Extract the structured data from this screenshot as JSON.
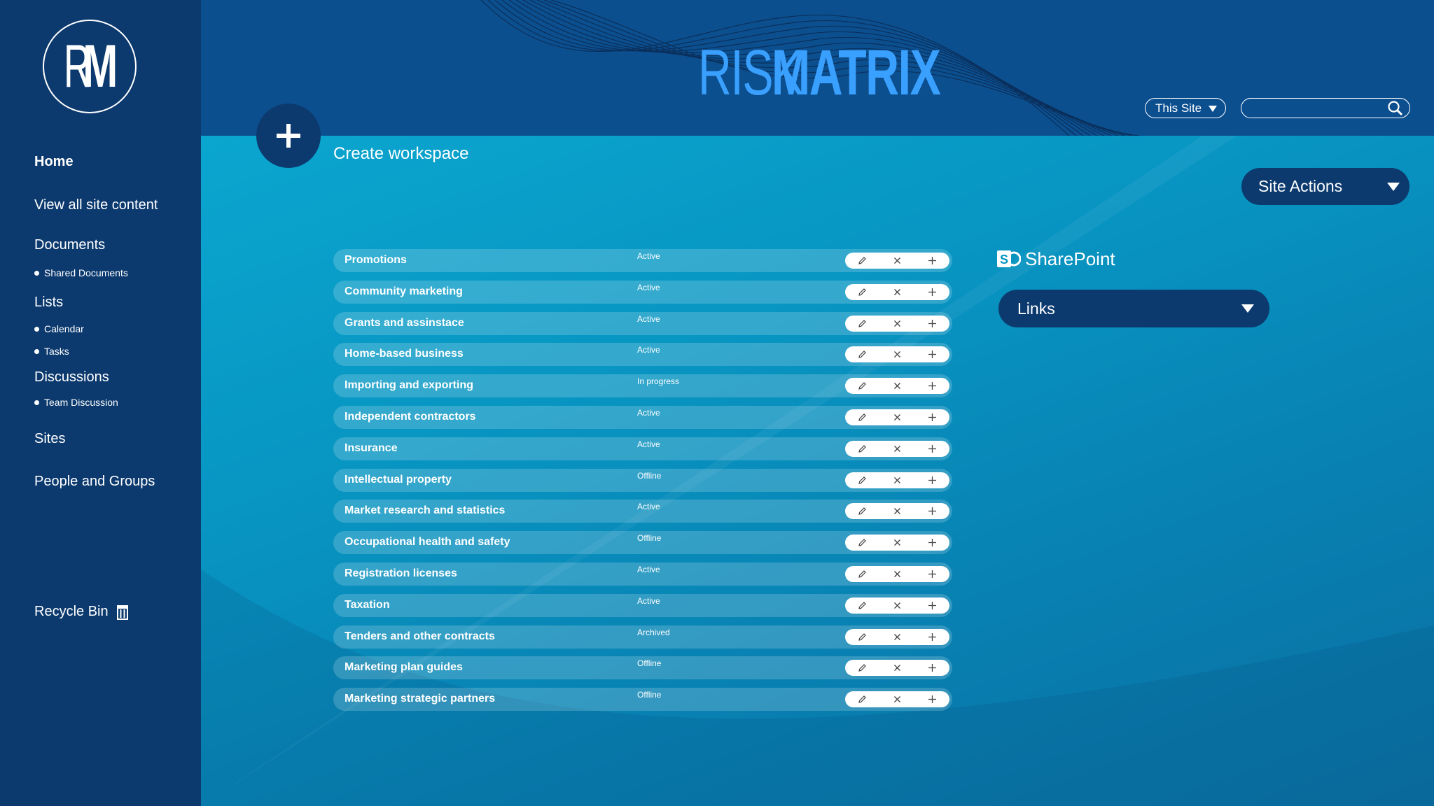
{
  "logo": {
    "left": "R",
    "right": "M"
  },
  "sidebar": {
    "home": "Home",
    "view_all": "View all site content",
    "documents": "Documents",
    "shared_documents": "Shared Documents",
    "lists": "Lists",
    "calendar": "Calendar",
    "tasks": "Tasks",
    "discussions": "Discussions",
    "team_discussion": "Team Discussion",
    "sites": "Sites",
    "people_groups": "People and Groups",
    "recycle_bin": "Recycle Bin"
  },
  "header": {
    "brand_light": "RISK",
    "brand_bold": "MATRIX",
    "scope": "This Site",
    "search_placeholder": ""
  },
  "create": {
    "label": "Create workspace"
  },
  "site_actions": "Site Actions",
  "sharepoint": "SharePoint",
  "links": "Links",
  "rows": [
    {
      "name": "Promotions",
      "status": "Active"
    },
    {
      "name": "Community marketing",
      "status": "Active"
    },
    {
      "name": "Grants and assinstace",
      "status": "Active"
    },
    {
      "name": "Home-based business",
      "status": "Active"
    },
    {
      "name": "Importing and exporting",
      "status": "In progress"
    },
    {
      "name": "Independent contractors",
      "status": "Active"
    },
    {
      "name": "Insurance",
      "status": "Active"
    },
    {
      "name": "Intellectual property",
      "status": "Offline"
    },
    {
      "name": "Market research and statistics",
      "status": "Active"
    },
    {
      "name": "Occupational health and safety",
      "status": "Offline"
    },
    {
      "name": "Registration licenses",
      "status": "Active"
    },
    {
      "name": "Taxation",
      "status": "Active"
    },
    {
      "name": "Tenders and other contracts",
      "status": "Archived"
    },
    {
      "name": "Marketing plan guides",
      "status": "Offline"
    },
    {
      "name": "Marketing strategic partners",
      "status": "Offline"
    }
  ],
  "colors": {
    "sidebar": "#0c3a6e",
    "header": "#0c4f8f",
    "brand": "#3aa0ff",
    "main": "#0895c2"
  }
}
